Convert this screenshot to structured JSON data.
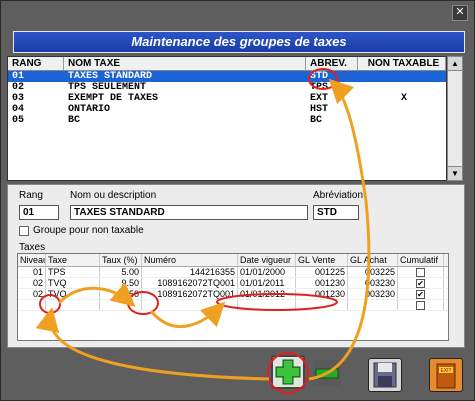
{
  "window": {
    "close_glyph": "✕"
  },
  "title": "Maintenance des groupes de taxes",
  "groups_table": {
    "headers": [
      "RANG",
      "NOM TAXE",
      "ABREV.",
      "NON TAXABLE"
    ],
    "rows": [
      {
        "rang": "01",
        "nom": "TAXES STANDARD",
        "abrev": "STD",
        "non_taxable": ""
      },
      {
        "rang": "02",
        "nom": "TPS SEULEMENT",
        "abrev": "TPS",
        "non_taxable": ""
      },
      {
        "rang": "03",
        "nom": "EXEMPT DE TAXES",
        "abrev": "EXT",
        "non_taxable": "X"
      },
      {
        "rang": "04",
        "nom": "ONTARIO",
        "abrev": "HST",
        "non_taxable": ""
      },
      {
        "rang": "05",
        "nom": "BC",
        "abrev": "BC",
        "non_taxable": ""
      }
    ],
    "selected_index": 0
  },
  "detail": {
    "rang_label": "Rang",
    "rang_value": "01",
    "nom_label": "Nom ou description",
    "nom_value": "TAXES STANDARD",
    "abrev_label": "Abréviation",
    "abrev_value": "STD",
    "non_taxable_label": "Groupe pour non taxable",
    "taxes_label": "Taxes"
  },
  "taxes_table": {
    "headers": [
      "Niveau",
      "Taxe",
      "Taux (%)",
      "Numéro",
      "Date vigueur",
      "GL Vente",
      "GL Achat",
      "Cumulatif"
    ],
    "rows": [
      {
        "niveau": "01",
        "taxe": "TPS",
        "taux": "5.00",
        "numero": "144216355",
        "date": "01/01/2000",
        "gl_vente": "001225",
        "gl_achat": "003225",
        "cumulatif": false
      },
      {
        "niveau": "02",
        "taxe": "TVQ",
        "taux": "9.50",
        "numero": "1089162072TQ001",
        "date": "01/01/2011",
        "gl_vente": "001230",
        "gl_achat": "003230",
        "cumulatif": true
      },
      {
        "niveau": "02",
        "taxe": "TVQ",
        "taux": "9.50",
        "numero": "1089162072TQ001",
        "date": "01/01/2012",
        "gl_vente": "001230",
        "gl_achat": "003230",
        "cumulatif": true
      }
    ]
  },
  "toolbar": {
    "add_icon": "plus-icon",
    "delete_icon": "minus-icon",
    "save_icon": "floppy-icon",
    "exit_label": "EXIT"
  },
  "colors": {
    "title_bg": "#1a3ea8",
    "selection": "#1c63d6",
    "annotation": "#f0a020",
    "highlight_circle": "#e02020",
    "add_green": "#2aa82a"
  }
}
